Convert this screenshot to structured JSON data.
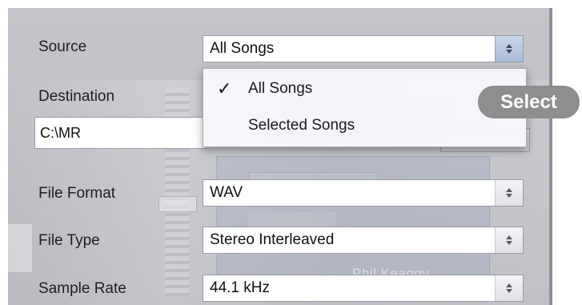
{
  "source": {
    "label": "Source",
    "value": "All Songs"
  },
  "destination": {
    "label": "Destination",
    "value": "C:\\MR"
  },
  "dropdown": {
    "check_mark": "✓",
    "items": [
      {
        "label": "All Songs",
        "checked": true
      },
      {
        "label": "Selected Songs",
        "checked": false
      }
    ]
  },
  "file_format": {
    "label": "File Format",
    "value": "WAV"
  },
  "file_type": {
    "label": "File Type",
    "value": "Stereo Interleaved"
  },
  "sample_rate": {
    "label": "Sample Rate",
    "value": "44.1 kHz"
  },
  "background": {
    "artist_text": "Phil Keaggy"
  },
  "overlay": {
    "select_label": "Select"
  },
  "colors": {
    "panel": "#c0c2c7",
    "stepper_active": "#a9bcd8",
    "pill": "#8e8e8e"
  }
}
